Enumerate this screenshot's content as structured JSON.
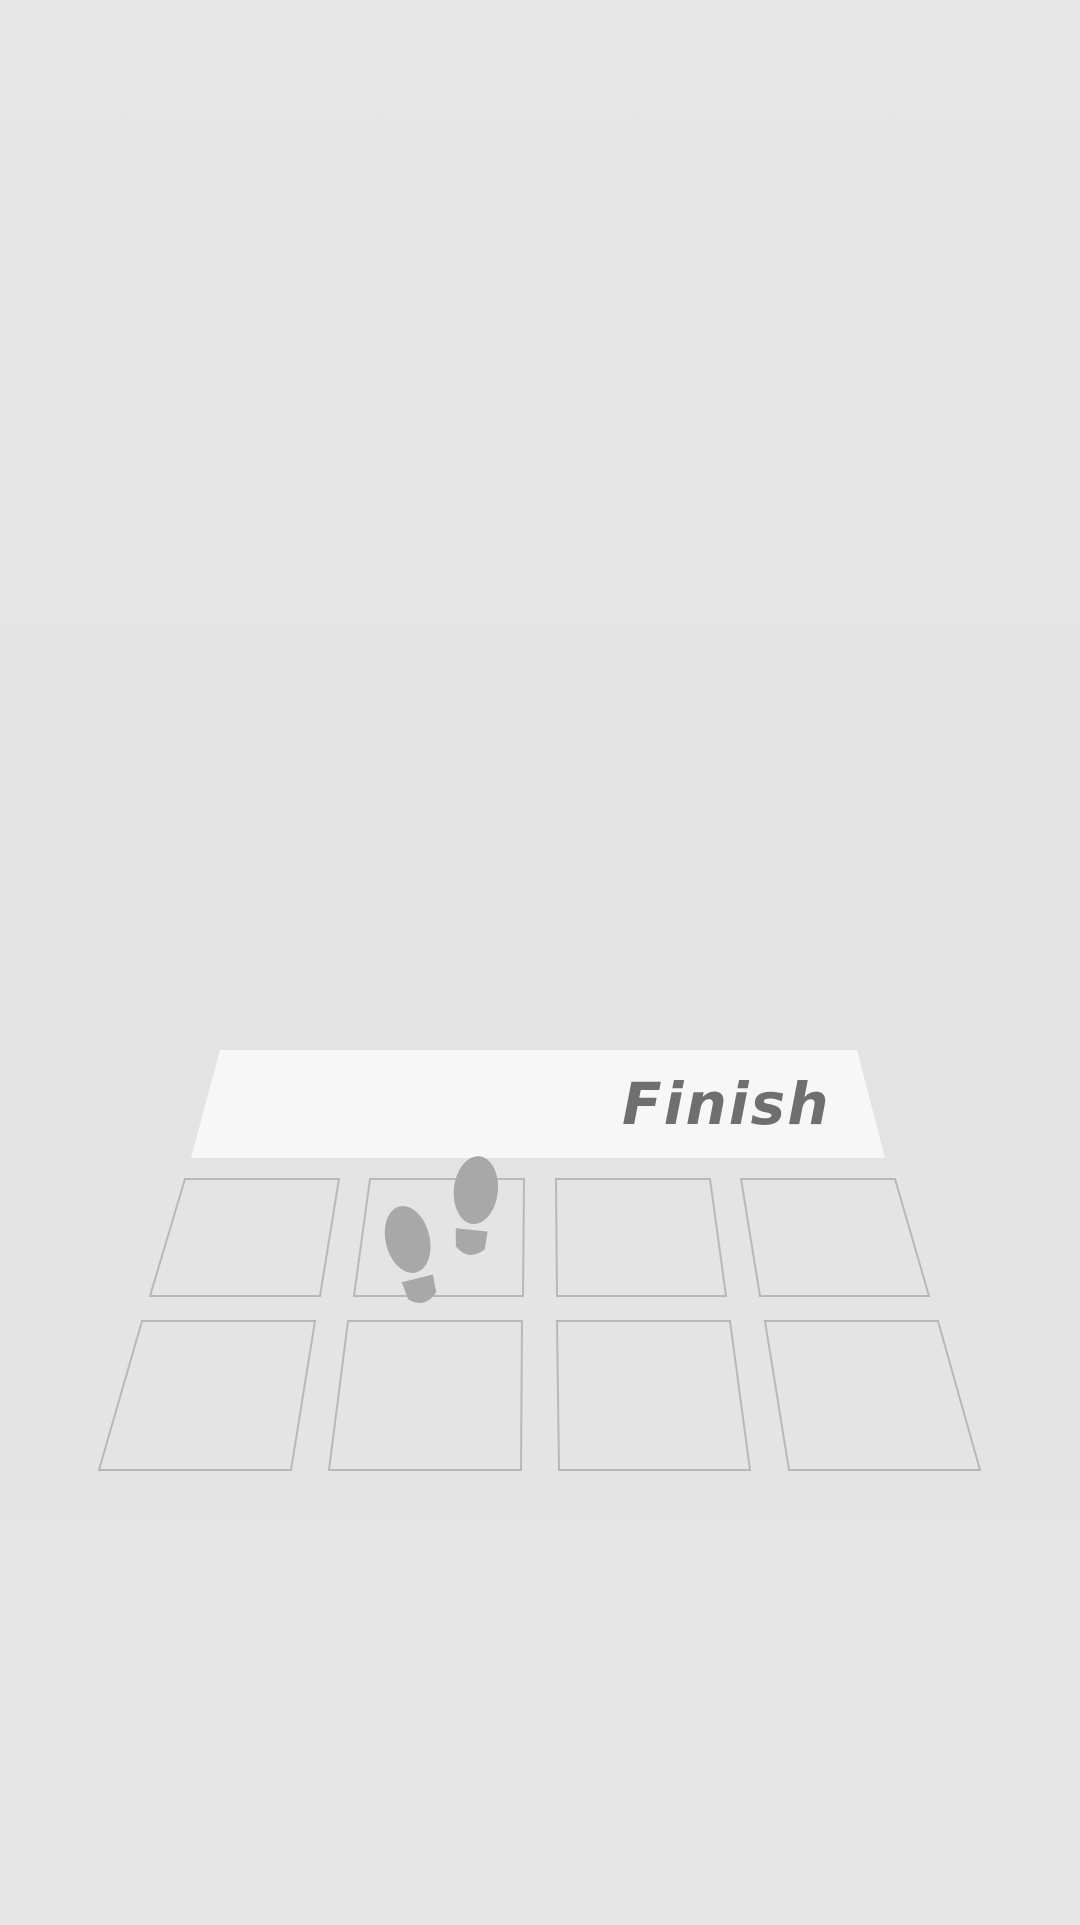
{
  "finish": {
    "label": "Finish"
  },
  "grid": {
    "rows": 2,
    "columns": 4
  },
  "player": {
    "icon": "footprints-icon",
    "row": 1,
    "column": 2
  },
  "colors": {
    "background": "#e6e6e6",
    "banner": "#f7f7f7",
    "banner_text": "#6f6f6f",
    "tile_outline": "#b8b8b8",
    "footprints": "#a8a8a8"
  }
}
